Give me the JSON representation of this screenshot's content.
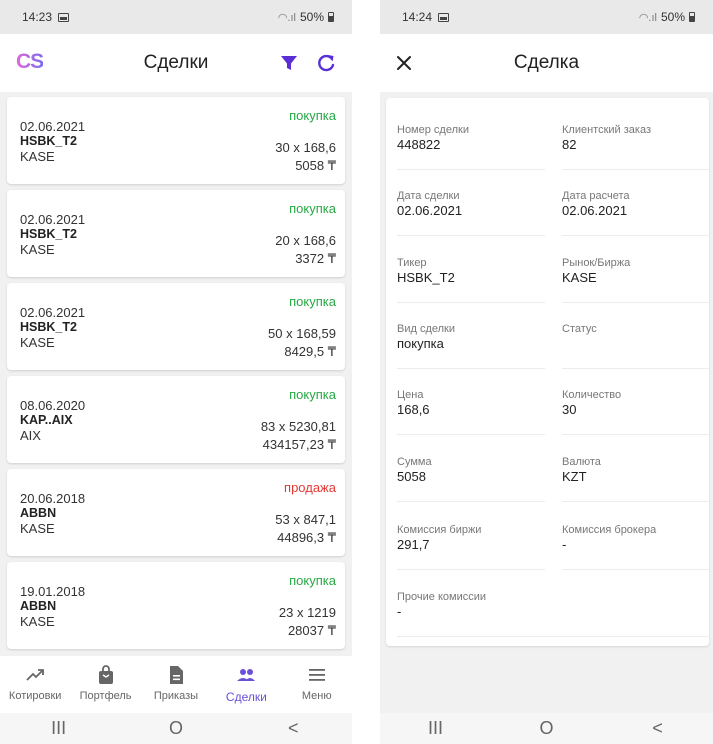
{
  "left_screen": {
    "status_bar": {
      "time": "14:23",
      "battery": "50%"
    },
    "app_bar": {
      "logo": "CS",
      "title": "Сделки"
    },
    "trades": [
      {
        "date": "02.06.2021",
        "ticker": "HSBK_T2",
        "market": "KASE",
        "side": "покупка",
        "side_type": "buy",
        "qty_price": "30 x 168,6",
        "sum": "5058 ₸"
      },
      {
        "date": "02.06.2021",
        "ticker": "HSBK_T2",
        "market": "KASE",
        "side": "покупка",
        "side_type": "buy",
        "qty_price": "20 x 168,6",
        "sum": "3372 ₸"
      },
      {
        "date": "02.06.2021",
        "ticker": "HSBK_T2",
        "market": "KASE",
        "side": "покупка",
        "side_type": "buy",
        "qty_price": "50 x 168,59",
        "sum": "8429,5 ₸"
      },
      {
        "date": "08.06.2020",
        "ticker": "KAP..AIX",
        "market": "AIX",
        "side": "покупка",
        "side_type": "buy",
        "qty_price": "83 x 5230,81",
        "sum": "434157,23 ₸"
      },
      {
        "date": "20.06.2018",
        "ticker": "ABBN",
        "market": "KASE",
        "side": "продажа",
        "side_type": "sell",
        "qty_price": "53 x 847,1",
        "sum": "44896,3 ₸"
      },
      {
        "date": "19.01.2018",
        "ticker": "ABBN",
        "market": "KASE",
        "side": "покупка",
        "side_type": "buy",
        "qty_price": "23 x 1219",
        "sum": "28037 ₸"
      }
    ],
    "bottom_nav": {
      "quotes": "Котировки",
      "portfolio": "Портфель",
      "orders": "Приказы",
      "trades": "Сделки",
      "menu": "Меню"
    }
  },
  "right_screen": {
    "status_bar": {
      "time": "14:24",
      "battery": "50%"
    },
    "app_bar": {
      "title": "Сделка"
    },
    "fields": {
      "deal_number": {
        "label": "Номер сделки",
        "value": "448822"
      },
      "client_order": {
        "label": "Клиентский заказ",
        "value": "82"
      },
      "deal_date": {
        "label": "Дата сделки",
        "value": "02.06.2021"
      },
      "settle_date": {
        "label": "Дата расчета",
        "value": "02.06.2021"
      },
      "ticker": {
        "label": "Тикер",
        "value": "HSBK_T2"
      },
      "market": {
        "label": "Рынок/Биржа",
        "value": "KASE"
      },
      "deal_type": {
        "label": "Вид сделки",
        "value": "покупка"
      },
      "status": {
        "label": "Статус",
        "value": ""
      },
      "price": {
        "label": "Цена",
        "value": "168,6"
      },
      "quantity": {
        "label": "Количество",
        "value": "30"
      },
      "amount": {
        "label": "Сумма",
        "value": "5058"
      },
      "currency": {
        "label": "Валюта",
        "value": "KZT"
      },
      "exchange_fee": {
        "label": "Комиссия биржи",
        "value": "291,7"
      },
      "broker_fee": {
        "label": "Комиссия брокера",
        "value": "-"
      },
      "other_fees": {
        "label": "Прочие комиссии",
        "value": "-"
      }
    }
  },
  "system_nav": {
    "recents": "III",
    "home": "O",
    "back": "<"
  },
  "colors": {
    "accent": "#6a4fd8",
    "buy": "#27a844",
    "sell": "#e53935",
    "filter": "#5b2fd6"
  }
}
